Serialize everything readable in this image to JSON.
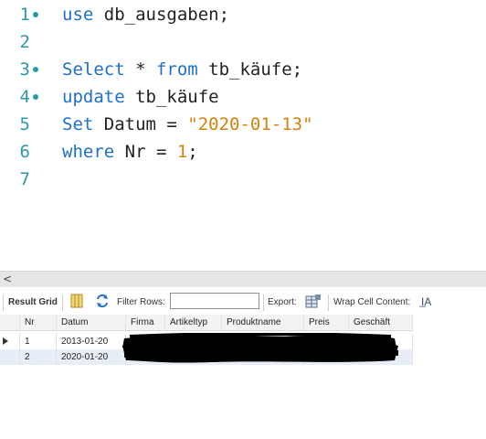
{
  "editor": {
    "lines": [
      {
        "num": "1",
        "bullet": true,
        "parts": [
          {
            "t": "use",
            "c": "kw"
          },
          {
            "t": " db_ausgaben;",
            "c": ""
          }
        ]
      },
      {
        "num": "2",
        "bullet": false,
        "parts": []
      },
      {
        "num": "3",
        "bullet": true,
        "parts": [
          {
            "t": "Select",
            "c": "kw"
          },
          {
            "t": " * ",
            "c": ""
          },
          {
            "t": "from",
            "c": "kw"
          },
          {
            "t": " tb_käufe;",
            "c": ""
          }
        ]
      },
      {
        "num": "4",
        "bullet": true,
        "parts": [
          {
            "t": "update",
            "c": "kw"
          },
          {
            "t": " tb_käufe",
            "c": ""
          }
        ]
      },
      {
        "num": "5",
        "bullet": false,
        "parts": [
          {
            "t": "Set",
            "c": "kw"
          },
          {
            "t": " Datum = ",
            "c": ""
          },
          {
            "t": "\"2020-01-13\"",
            "c": "str"
          }
        ]
      },
      {
        "num": "6",
        "bullet": false,
        "parts": [
          {
            "t": "where",
            "c": "kw"
          },
          {
            "t": " Nr = ",
            "c": ""
          },
          {
            "t": "1",
            "c": "num"
          },
          {
            "t": ";",
            "c": ""
          }
        ]
      },
      {
        "num": "7",
        "bullet": false,
        "parts": []
      }
    ]
  },
  "scrollbar": {
    "left_arrow": "<"
  },
  "toolbar": {
    "result_grid_label": "Result Grid",
    "filter_rows_label": "Filter Rows:",
    "filter_value": "",
    "export_label": "Export:",
    "wrap_label": "Wrap Cell Content:",
    "wrap_icon_glyph": "I̲A"
  },
  "grid": {
    "columns": [
      "Nr",
      "Datum",
      "Firma",
      "Artikeltyp",
      "Produktname",
      "Preis",
      "Geschäft"
    ],
    "rows": [
      [
        "1",
        "2013-01-20",
        "",
        "",
        "",
        "",
        ""
      ],
      [
        "2",
        "2020-01-20",
        "",
        "",
        "",
        "",
        ""
      ]
    ]
  },
  "colors": {
    "keyword": "#1e6fd0",
    "string": "#d4820c",
    "line_number": "#2b9aa8",
    "selected_row": "#e8eef8"
  }
}
